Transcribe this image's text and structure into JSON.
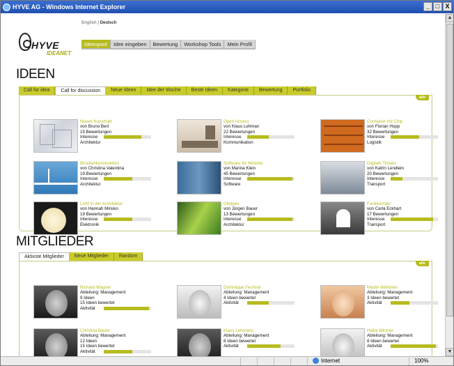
{
  "window": {
    "title": "HYVE AG - Windows Internet Explorer",
    "min": "_",
    "max": "□",
    "close": "X"
  },
  "lang": {
    "en": "English",
    "sep": "|",
    "de": "Deutsch"
  },
  "logo": {
    "word": "HYVE",
    "sub": "IDEANET"
  },
  "mainnav": [
    "Ideenpool",
    "Idee eingeben",
    "Bewertung",
    "Workshop Tools",
    "Mein Profil"
  ],
  "ideen": {
    "heading": "IDEEN",
    "tabs": [
      "Call for idea",
      "Call for discussion",
      "Neue Ideen",
      "Idee der Woche",
      "Beste Ideen",
      "Kategorie",
      "Bewertung",
      "Portfolio"
    ],
    "active_tab": 1,
    "alle": "alle",
    "interest_label": "Interesse",
    "cards": [
      {
        "title": "Neues Konstrukt",
        "author": "von Bruno Bert",
        "ratings": "15 Bewertungen",
        "interest": 0.8,
        "category": "Architektur"
      },
      {
        "title": "Open Access",
        "author": "von Klaus Lehman",
        "ratings": "22 Bewertungen",
        "interest": 0.45,
        "category": "Kommunikation"
      },
      {
        "title": "Container mit Chip",
        "author": "von Florian Hopp",
        "ratings": "32 Bewertungen",
        "interest": 0.6,
        "category": "Logistik"
      },
      {
        "title": "Brückenkonstruktion",
        "author": "von Christina Valentina",
        "ratings": "19 Bewertungen",
        "interest": 0.6,
        "category": "Architektur"
      },
      {
        "title": "Software für Minister",
        "author": "von Marina Klein",
        "ratings": "45 Bewertungen",
        "interest": 0.95,
        "category": "Software"
      },
      {
        "title": "Digitale Tickets",
        "author": "von Katrin Lendlein",
        "ratings": "20 Bewertungen",
        "interest": 0.25,
        "category": "Transport"
      },
      {
        "title": "Licht in der Architektur",
        "author": "von Hannah Minsko",
        "ratings": "19 Bewertungen",
        "interest": 0.6,
        "category": "Elektronik"
      },
      {
        "title": "Olipipes",
        "author": "von Jürgen Bauer",
        "ratings": "13 Bewertungen",
        "interest": 0.95,
        "category": "Architektur"
      },
      {
        "title": "Funkkontakt",
        "author": "von Carla Eckhart",
        "ratings": "17 Bewertungen",
        "interest": 0.9,
        "category": "Transport"
      }
    ]
  },
  "mitglieder": {
    "heading": "MITGLIEDER",
    "tabs": [
      "Aktivste Mitglieder",
      "Neue Mitglieder",
      "Random"
    ],
    "active_tab": 0,
    "alle": "alle",
    "activity_label": "Aktivität",
    "members": [
      {
        "name": "Richard Wagner",
        "dept": "Abteilung: Management",
        "ideas": "9 Ideen",
        "rated": "15 Ideen bewertet",
        "activity": 0.95
      },
      {
        "name": "Dominique Fechner",
        "dept": "Abteilung: Management",
        "ideas": "4 Ideen bewertet",
        "rated": "",
        "activity": 0.45
      },
      {
        "name": "Martin Wellstein",
        "dept": "Abteilung: Management",
        "ideas": "3 Ideen bewertet",
        "rated": "",
        "activity": 0.4
      },
      {
        "name": "Christina Bauer",
        "dept": "Abteilung: Management",
        "ideas": "12 Ideen",
        "rated": "15 Ideen bewertet",
        "activity": 0.6
      },
      {
        "name": "Klaus Lehmann",
        "dept": "Abteilung: Management",
        "ideas": "8 Ideen bewertet",
        "rated": "",
        "activity": 0.7
      },
      {
        "name": "Heike Mirzner",
        "dept": "Abteilung: Management",
        "ideas": "8 Ideen bewertet",
        "rated": "",
        "activity": 0.95
      }
    ]
  },
  "status": {
    "zone": "Internet",
    "zoom": "100%"
  }
}
